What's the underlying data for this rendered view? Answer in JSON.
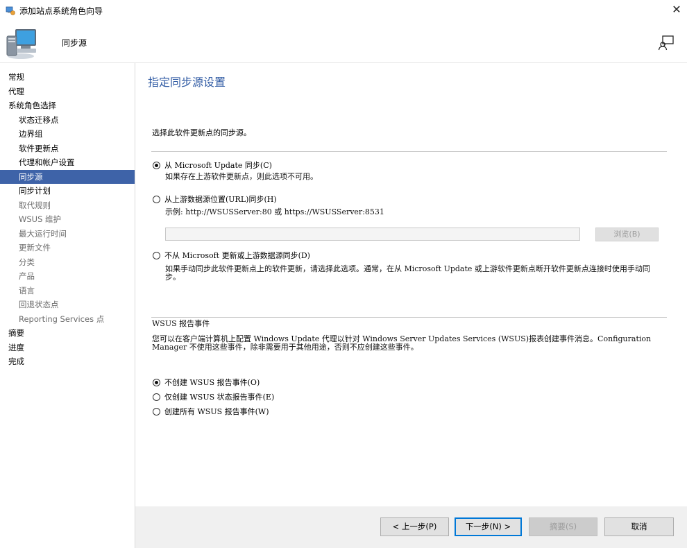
{
  "window": {
    "title": "添加站点系统角色向导",
    "close_glyph": "✕"
  },
  "header": {
    "title": "同步源"
  },
  "sidebar": {
    "items": [
      {
        "label": "常规",
        "level": 0,
        "state": "normal"
      },
      {
        "label": "代理",
        "level": 0,
        "state": "normal"
      },
      {
        "label": "系统角色选择",
        "level": 0,
        "state": "normal"
      },
      {
        "label": "状态迁移点",
        "level": 1,
        "state": "normal"
      },
      {
        "label": "边界组",
        "level": 1,
        "state": "normal"
      },
      {
        "label": "软件更新点",
        "level": 1,
        "state": "normal"
      },
      {
        "label": "代理和帐户设置",
        "level": 1,
        "state": "normal"
      },
      {
        "label": "同步源",
        "level": 1,
        "state": "active"
      },
      {
        "label": "同步计划",
        "level": 1,
        "state": "normal"
      },
      {
        "label": "取代规则",
        "level": 1,
        "state": "disabled"
      },
      {
        "label": "WSUS 维护",
        "level": 1,
        "state": "disabled"
      },
      {
        "label": "最大运行时间",
        "level": 1,
        "state": "disabled"
      },
      {
        "label": "更新文件",
        "level": 1,
        "state": "disabled"
      },
      {
        "label": "分类",
        "level": 1,
        "state": "disabled"
      },
      {
        "label": "产品",
        "level": 1,
        "state": "disabled"
      },
      {
        "label": "语言",
        "level": 1,
        "state": "disabled"
      },
      {
        "label": "回退状态点",
        "level": 1,
        "state": "disabled"
      },
      {
        "label": "Reporting Services 点",
        "level": 1,
        "state": "disabled"
      },
      {
        "label": "摘要",
        "level": 0,
        "state": "normal"
      },
      {
        "label": "进度",
        "level": 0,
        "state": "normal"
      },
      {
        "label": "完成",
        "level": 0,
        "state": "normal"
      }
    ]
  },
  "main": {
    "section_title": "指定同步源设置",
    "intro": "选择此软件更新点的同步源。",
    "source_options": [
      {
        "label": "从 Microsoft Update 同步(C)",
        "selected": true,
        "note": "如果存在上游软件更新点，则此选项不可用。"
      },
      {
        "label": "从上游数据源位置(URL)同步(H)",
        "selected": false,
        "note": "示例: http://WSUSServer:80 或 https://WSUSServer:8531"
      },
      {
        "label": "不从 Microsoft 更新或上游数据源同步(D)",
        "selected": false,
        "note": "如果手动同步此软件更新点上的软件更新，请选择此选项。通常，在从 Microsoft Update 或上游软件更新点断开软件更新点连接时使用手动同步。"
      }
    ],
    "url_input": {
      "value": "",
      "placeholder": ""
    },
    "browse_label": "浏览(B)",
    "wsus": {
      "heading": "WSUS 报告事件",
      "description": "您可以在客户端计算机上配置 Windows Update 代理以针对 Windows Server Updates Services (WSUS)报表创建事件消息。Configuration Manager 不使用这些事件，除非需要用于其他用途，否则不应创建这些事件。",
      "options": [
        {
          "label": "不创建 WSUS 报告事件(O)",
          "selected": true
        },
        {
          "label": "仅创建 WSUS 状态报告事件(E)",
          "selected": false
        },
        {
          "label": "创建所有 WSUS 报告事件(W)",
          "selected": false
        }
      ]
    }
  },
  "footer": {
    "prev_label": "< 上一步(P)",
    "next_label": "下一步(N) >",
    "summary_label": "摘要(S)",
    "cancel_label": "取消"
  },
  "colors": {
    "accent": "#3e63a8",
    "title_blue": "#2f5aa3",
    "footer_bg": "#f0f0f0",
    "primary_border": "#0078d7"
  }
}
